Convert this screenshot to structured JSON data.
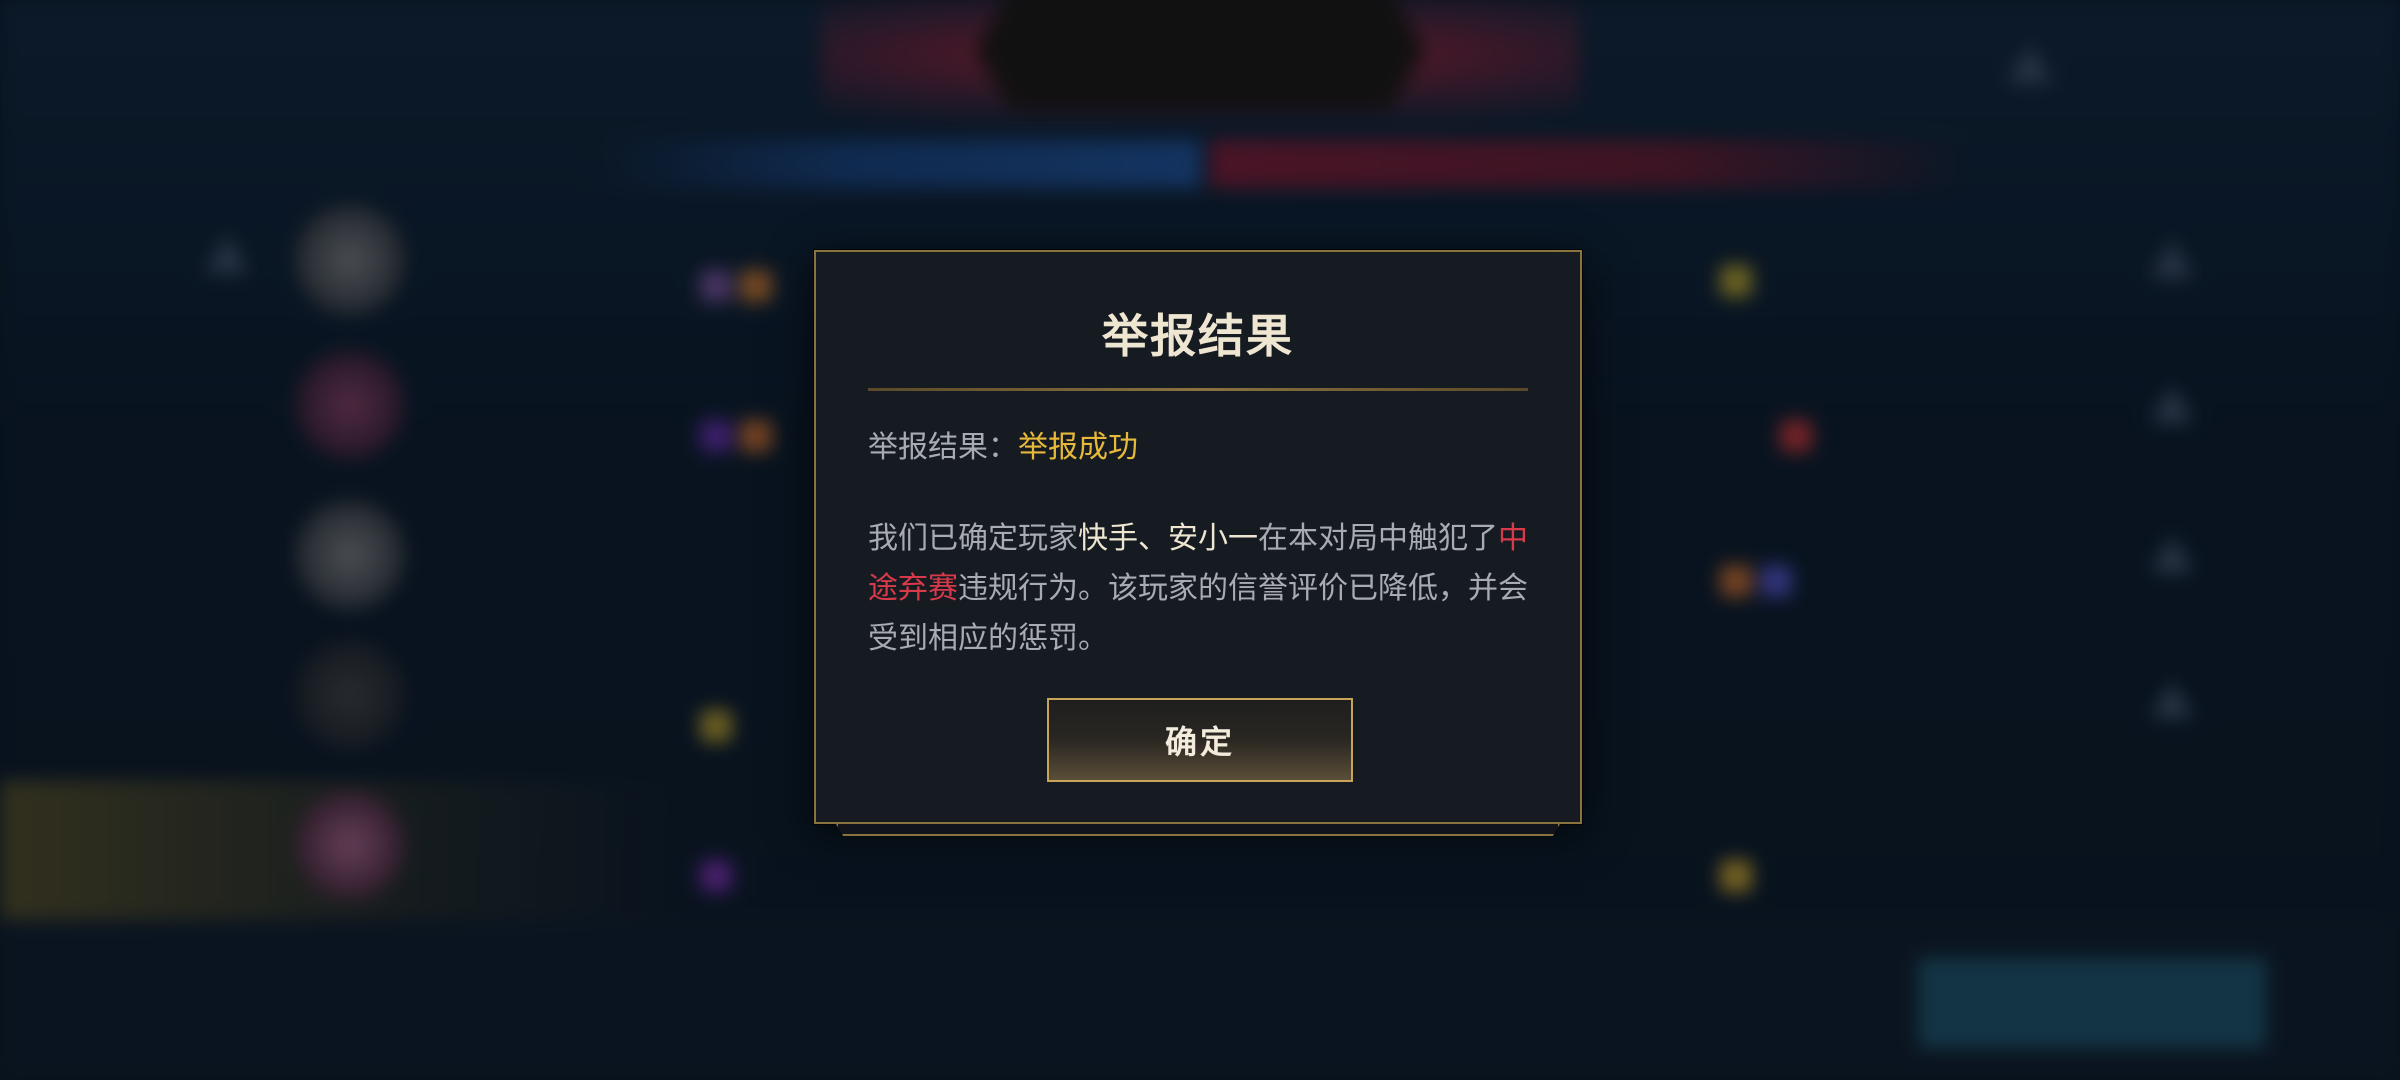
{
  "dialog": {
    "title": "举报结果",
    "result_label": "举报结果：",
    "result_value": "举报成功",
    "desc_prefix": "我们已确定玩家",
    "players": "快手、安小一",
    "desc_mid": "在本对局中触犯了",
    "violation": "中途弃赛",
    "desc_suffix": "违规行为。该玩家的信誉评价已降低，并会受到相应的惩罚。",
    "confirm_label": "确定"
  },
  "colors": {
    "accent_gold": "#c8a458",
    "success_yellow": "#e7b93a",
    "violation_red": "#d93a4a",
    "dialog_bg": "#161b22"
  },
  "icons": {
    "warning": "warning-triangle-icon"
  }
}
